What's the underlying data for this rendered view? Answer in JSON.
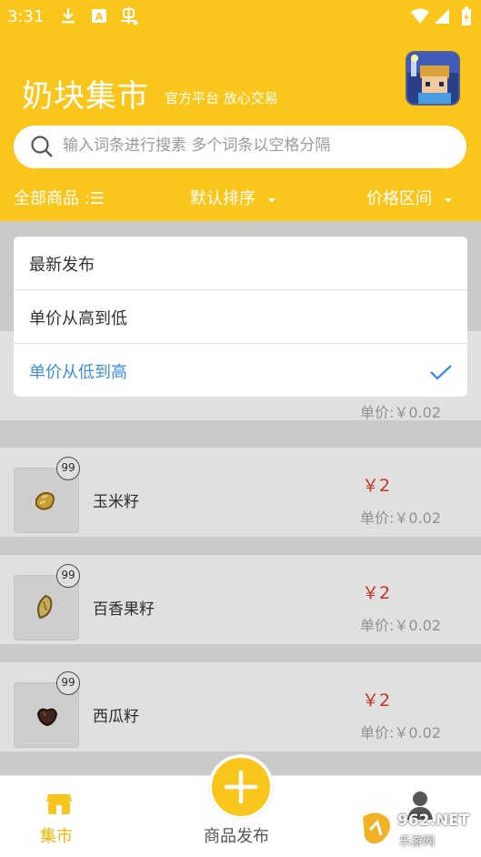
{
  "status": {
    "time": "3:31"
  },
  "header": {
    "title": "奶块集市",
    "subtitle": "官方平台 放心交易"
  },
  "search": {
    "placeholder": "输入词条进行搜素 多个词条以空格分隔"
  },
  "filters": {
    "all_items": "全部商品 :☰",
    "default_sort": "默认排序",
    "price_range": "价格区间"
  },
  "sort_menu": {
    "options": [
      "最新发布",
      "单价从高到低",
      "单价从低到高"
    ],
    "selected_index": 2
  },
  "items": [
    {
      "name": "",
      "qty": "",
      "price": "",
      "unit_price": "单价:￥0.02"
    },
    {
      "name": "玉米籽",
      "qty": "99",
      "price": "￥2",
      "unit_price": "单价:￥0.02"
    },
    {
      "name": "百香果籽",
      "qty": "99",
      "price": "￥2",
      "unit_price": "单价:￥0.02"
    },
    {
      "name": "西瓜籽",
      "qty": "99",
      "price": "￥2",
      "unit_price": "单价:￥0.02"
    }
  ],
  "tabs": {
    "market": "集市",
    "publish": "商品发布"
  },
  "watermark": {
    "text": "962.NET",
    "sub": "乐游网"
  },
  "colors": {
    "brand": "#fbc61b",
    "price": "#e03c2e",
    "selected": "#3d8ee0"
  }
}
